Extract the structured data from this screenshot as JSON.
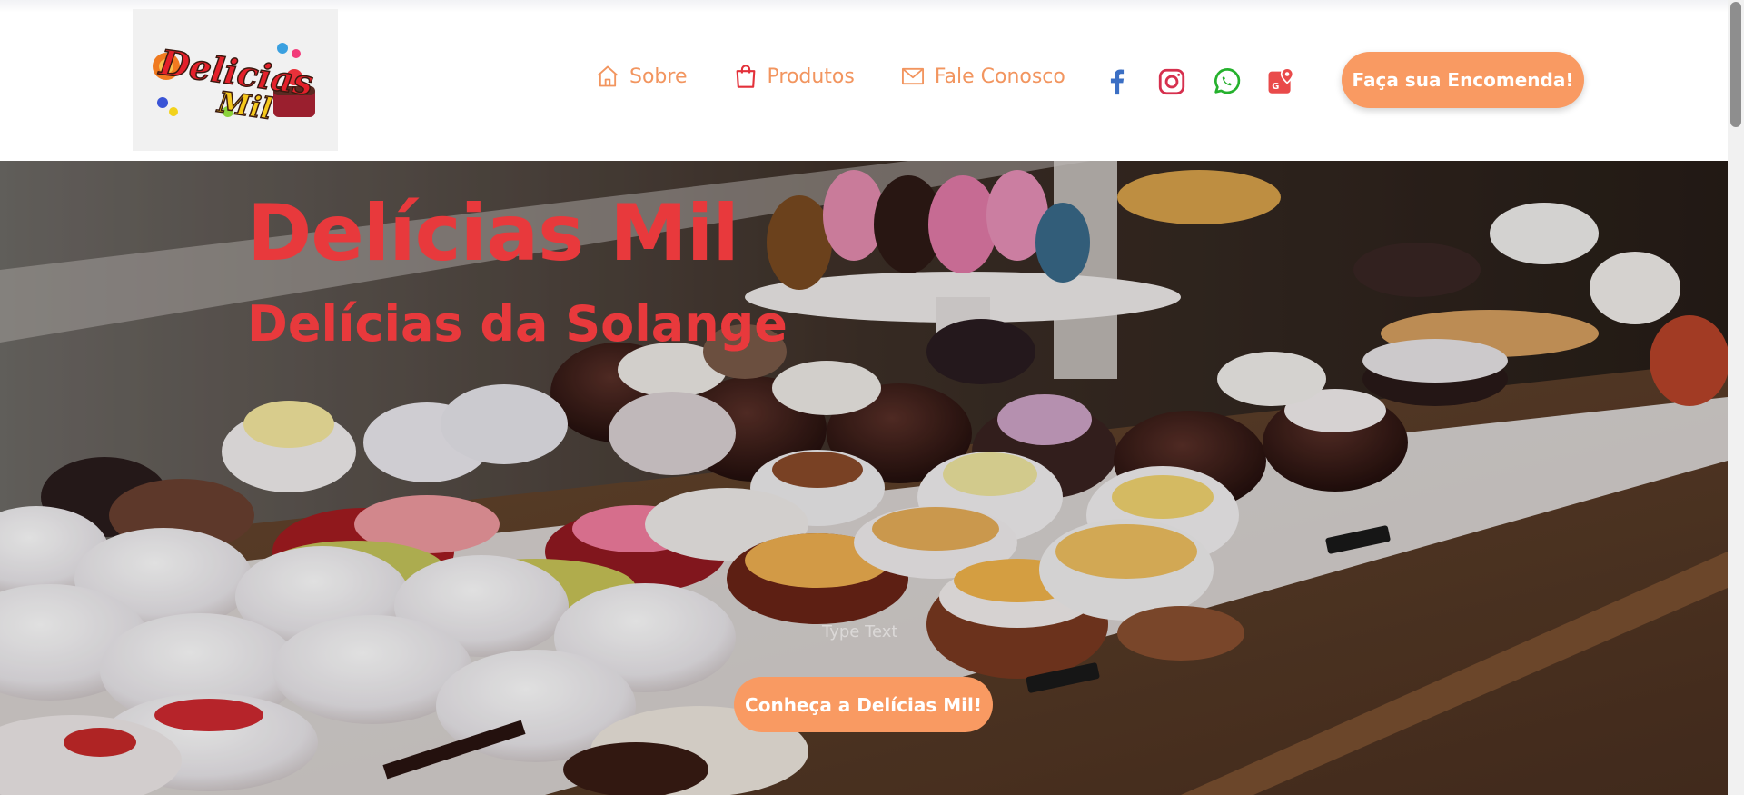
{
  "header": {
    "logo": {
      "text_line1": "Delicias",
      "text_line2": "Mil"
    },
    "nav": [
      {
        "label": "Sobre",
        "icon": "home-icon"
      },
      {
        "label": "Produtos",
        "icon": "shopping-bag-icon"
      },
      {
        "label": "Fale Conosco",
        "icon": "envelope-icon"
      }
    ],
    "social": [
      {
        "icon": "facebook-icon",
        "color": "#3b5998"
      },
      {
        "icon": "instagram-icon",
        "color": "#d6304e"
      },
      {
        "icon": "whatsapp-icon",
        "color": "#25b12d"
      },
      {
        "icon": "google-maps-icon",
        "color": "#e94040"
      }
    ],
    "order_button": "Faça sua Encomenda!"
  },
  "hero": {
    "title": "Delícias Mil",
    "subtitle": "Delícias da Solange",
    "type_text": "Type Text",
    "cta_button": "Conheça a Delícias Mil!"
  },
  "colors": {
    "accent": "#f99a62",
    "nav_text": "#f2955f",
    "hero_text": "#e8393c"
  }
}
